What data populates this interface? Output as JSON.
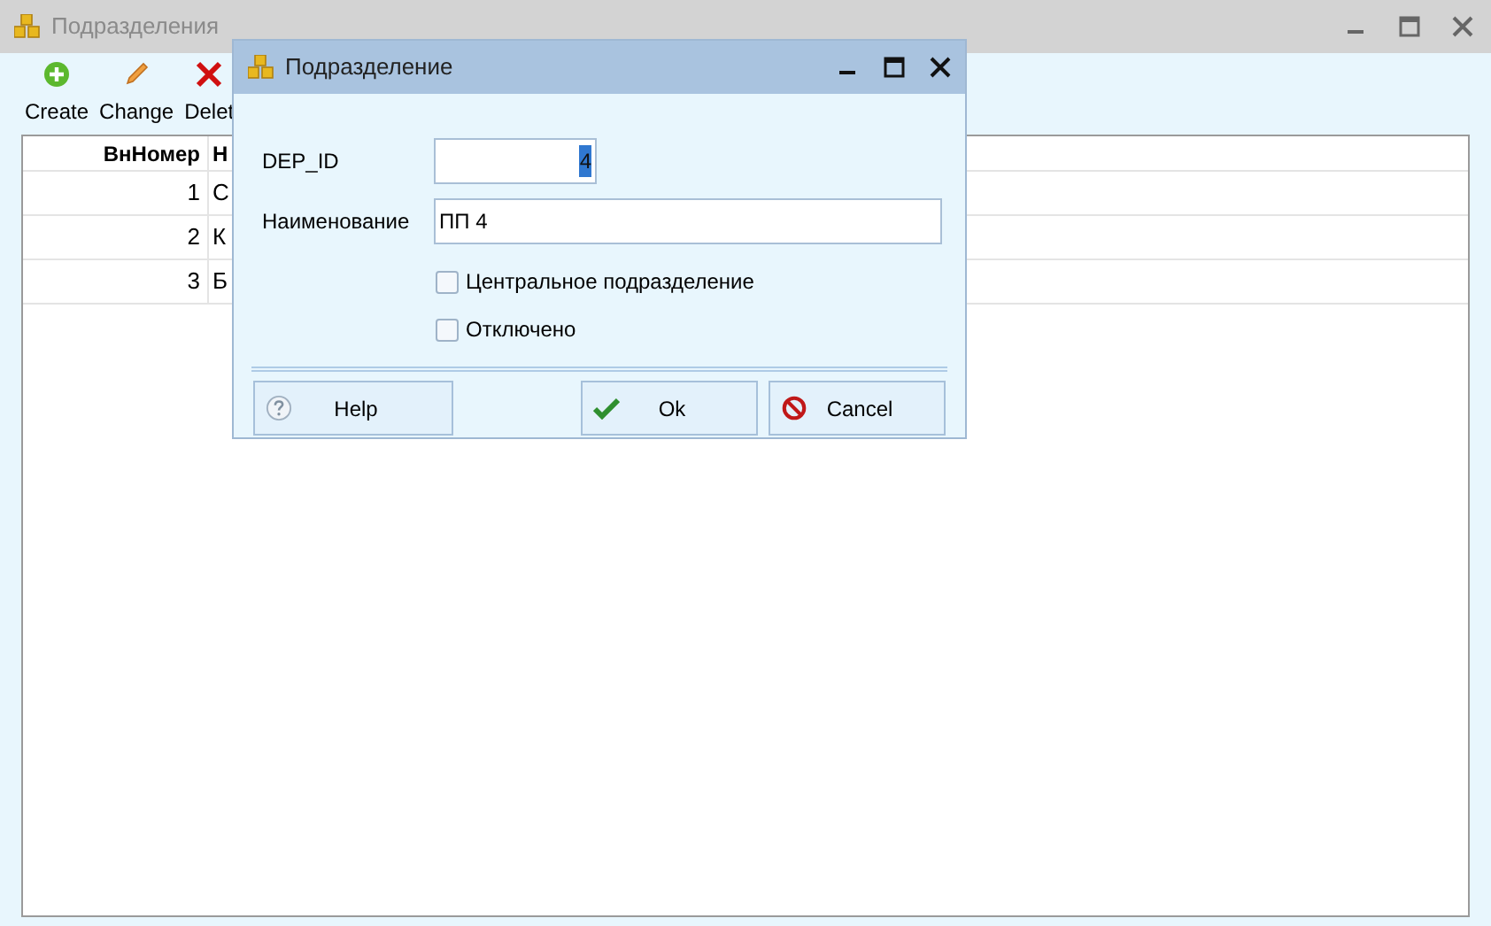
{
  "window": {
    "title": "Подразделения"
  },
  "toolbar": [
    {
      "label": "Create",
      "kind": "add"
    },
    {
      "label": "Change",
      "kind": "edit"
    },
    {
      "label": "Delet",
      "kind": "delete"
    }
  ],
  "table": {
    "columns": [
      "ВнНомер",
      "Н"
    ],
    "rows": [
      [
        "1",
        "С"
      ],
      [
        "2",
        "К"
      ],
      [
        "3",
        "Б"
      ]
    ]
  },
  "dialog": {
    "title": "Подразделение",
    "fields": [
      {
        "label": "DEP_ID",
        "value": "4",
        "text_selected": true,
        "kind": "short"
      },
      {
        "label": "Наименование",
        "value": "ПП 4",
        "text_selected": false,
        "kind": "wide"
      }
    ],
    "checkboxes": [
      {
        "label": "Центральное подразделение",
        "checked": false
      },
      {
        "label": "Отключено",
        "checked": false
      }
    ],
    "buttons": [
      {
        "label": "Help",
        "kind": "help"
      },
      {
        "label": "Ok",
        "kind": "ok"
      },
      {
        "label": "Cancel",
        "kind": "cancel"
      }
    ]
  }
}
